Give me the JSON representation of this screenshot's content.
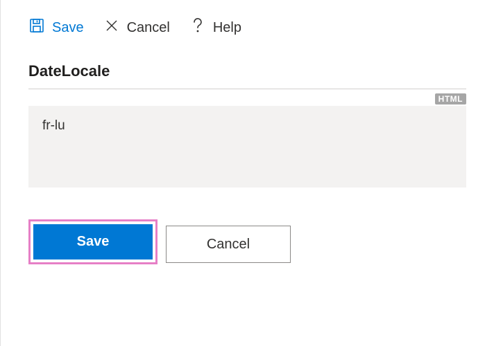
{
  "toolbar": {
    "save_label": "Save",
    "cancel_label": "Cancel",
    "help_label": "Help"
  },
  "field": {
    "label": "DateLocale",
    "badge": "HTML",
    "value": "fr-lu"
  },
  "actions": {
    "save_label": "Save",
    "cancel_label": "Cancel"
  }
}
